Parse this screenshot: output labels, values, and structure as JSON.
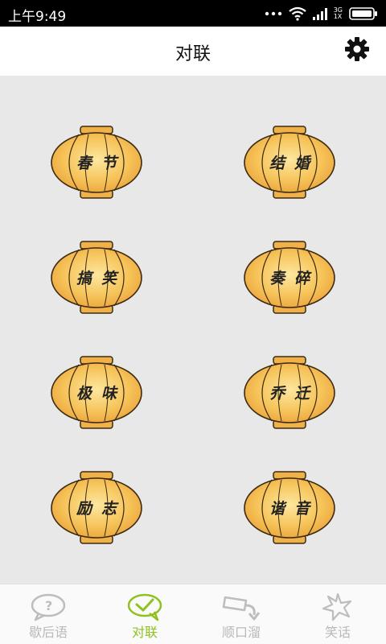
{
  "status_bar": {
    "time": "上午9:49",
    "network_top": "3G",
    "network_bottom": "1X"
  },
  "header": {
    "title": "对联",
    "settings_icon": "gear-icon"
  },
  "colors": {
    "accent": "#8dc21f",
    "lantern_fill": "#f3b94a",
    "lantern_highlight": "#fde7a0",
    "background": "#e8e8e8"
  },
  "categories": [
    {
      "label": "春节"
    },
    {
      "label": "结婚"
    },
    {
      "label": "搞笑"
    },
    {
      "label": "奏碎"
    },
    {
      "label": "极味"
    },
    {
      "label": "乔迁"
    },
    {
      "label": "励志"
    },
    {
      "label": "谐音"
    }
  ],
  "tabs": [
    {
      "label": "歇后语",
      "icon": "speech-bubble-icon",
      "active": false
    },
    {
      "label": "对联",
      "icon": "check-bubble-icon",
      "active": true
    },
    {
      "label": "顺口溜",
      "icon": "film-arrow-icon",
      "active": false
    },
    {
      "label": "笑话",
      "icon": "star-burst-icon",
      "active": false
    }
  ]
}
